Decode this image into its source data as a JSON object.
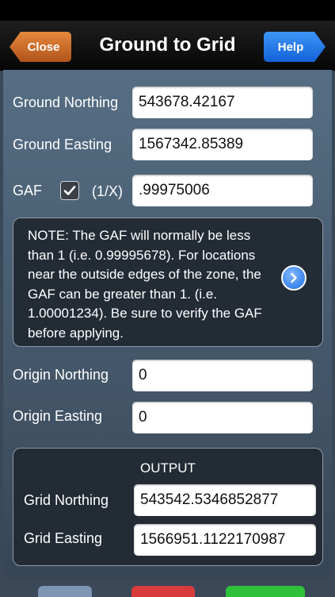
{
  "nav": {
    "title": "Ground to Grid",
    "close_label": "Close",
    "help_label": "Help"
  },
  "inputs": {
    "ground_northing": {
      "label": "Ground Northing",
      "value": "543678.42167"
    },
    "ground_easting": {
      "label": "Ground Easting",
      "value": "1567342.85389"
    },
    "gaf": {
      "label": "GAF",
      "checked": true,
      "reciprocal_label": "(1/X)",
      "value": ".99975006"
    },
    "origin_northing": {
      "label": "Origin Northing",
      "value": "0"
    },
    "origin_easting": {
      "label": "Origin Easting",
      "value": "0"
    }
  },
  "note": {
    "text": "NOTE: The GAF will normally be less than 1 (i.e. 0.99995678). For locations near the outside edges of the zone, the GAF can be greater than 1.  (i.e. 1.00001234). Be sure to verify  the GAF before applying."
  },
  "output": {
    "title": "OUTPUT",
    "grid_northing": {
      "label": "Grid Northing",
      "value": "543542.5346852877"
    },
    "grid_easting": {
      "label": "Grid Easting",
      "value": "1566951.1122170987"
    }
  },
  "colors": {
    "close_button": "#c8692a",
    "help_button": "#2a7df0",
    "bottom_left": "#7f95b4",
    "bottom_mid": "#d83b3b",
    "bottom_right": "#2fc13a"
  },
  "icons": {
    "checkbox": "check-icon",
    "info": "chevron-right-circle-icon"
  }
}
